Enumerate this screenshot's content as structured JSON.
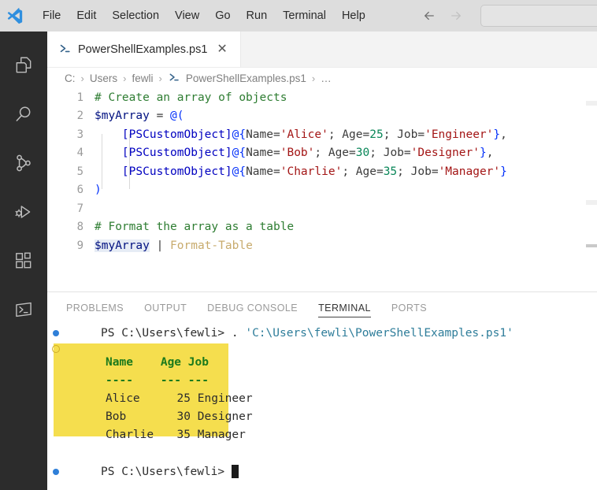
{
  "titlebar": {
    "logo_icon": "vscode-logo-icon",
    "menus": [
      "File",
      "Edit",
      "Selection",
      "View",
      "Go",
      "Run",
      "Terminal",
      "Help"
    ],
    "back_icon": "arrow-left-icon",
    "forward_icon": "arrow-right-icon",
    "search_value": "",
    "search_placeholder": ""
  },
  "activitybar": {
    "items": [
      {
        "name": "explorer",
        "icon": "files-icon"
      },
      {
        "name": "search",
        "icon": "search-icon"
      },
      {
        "name": "source-control",
        "icon": "source-control-icon"
      },
      {
        "name": "run-and-debug",
        "icon": "run-debug-icon"
      },
      {
        "name": "extensions",
        "icon": "extensions-icon"
      },
      {
        "name": "terminal",
        "icon": "terminal-prompt-icon"
      }
    ]
  },
  "editor": {
    "tab": {
      "label": "PowerShellExamples.ps1",
      "icon": "powershell-icon",
      "close_label": "✕",
      "active": true
    },
    "breadcrumbs": [
      {
        "label": "C:",
        "icon": ""
      },
      {
        "label": "Users",
        "icon": ""
      },
      {
        "label": "fewli",
        "icon": ""
      },
      {
        "label": "PowerShellExamples.ps1",
        "icon": "powershell-icon"
      },
      {
        "label": "…",
        "icon": ""
      }
    ],
    "breadcrumb_separator": "›",
    "lines": [
      {
        "number": "1",
        "tokens": [
          {
            "text": "# Create an array of objects",
            "cls": "t-comment"
          }
        ]
      },
      {
        "number": "2",
        "tokens": [
          {
            "text": "$myArray",
            "cls": "t-var"
          },
          {
            "text": " = ",
            "cls": "t-op"
          },
          {
            "text": "@(",
            "cls": "t-bracket"
          }
        ]
      },
      {
        "number": "3",
        "tokens": [
          {
            "text": "    ",
            "cls": "t-plain"
          },
          {
            "text": "[PSCustomObject]",
            "cls": "t-blue"
          },
          {
            "text": "@{",
            "cls": "t-bracket"
          },
          {
            "text": "Name=",
            "cls": "t-plain"
          },
          {
            "text": "'Alice'",
            "cls": "t-string"
          },
          {
            "text": "; Age=",
            "cls": "t-plain"
          },
          {
            "text": "25",
            "cls": "t-num"
          },
          {
            "text": "; Job=",
            "cls": "t-plain"
          },
          {
            "text": "'Engineer'",
            "cls": "t-string"
          },
          {
            "text": "}",
            "cls": "t-bracket"
          },
          {
            "text": ",",
            "cls": "t-plain"
          }
        ]
      },
      {
        "number": "4",
        "tokens": [
          {
            "text": "    ",
            "cls": "t-plain"
          },
          {
            "text": "[PSCustomObject]",
            "cls": "t-blue"
          },
          {
            "text": "@{",
            "cls": "t-bracket"
          },
          {
            "text": "Name=",
            "cls": "t-plain"
          },
          {
            "text": "'Bob'",
            "cls": "t-string"
          },
          {
            "text": "; Age=",
            "cls": "t-plain"
          },
          {
            "text": "30",
            "cls": "t-num"
          },
          {
            "text": "; Job=",
            "cls": "t-plain"
          },
          {
            "text": "'Designer'",
            "cls": "t-string"
          },
          {
            "text": "}",
            "cls": "t-bracket"
          },
          {
            "text": ",",
            "cls": "t-plain"
          }
        ]
      },
      {
        "number": "5",
        "tokens": [
          {
            "text": "    ",
            "cls": "t-plain"
          },
          {
            "text": "[PSCustomObject]",
            "cls": "t-blue"
          },
          {
            "text": "@{",
            "cls": "t-bracket"
          },
          {
            "text": "Name=",
            "cls": "t-plain"
          },
          {
            "text": "'Charlie'",
            "cls": "t-string"
          },
          {
            "text": "; Age=",
            "cls": "t-plain"
          },
          {
            "text": "35",
            "cls": "t-num"
          },
          {
            "text": "; Job=",
            "cls": "t-plain"
          },
          {
            "text": "'Manager'",
            "cls": "t-string"
          },
          {
            "text": "}",
            "cls": "t-bracket"
          }
        ]
      },
      {
        "number": "6",
        "tokens": [
          {
            "text": ")",
            "cls": "t-bracket"
          }
        ]
      },
      {
        "number": "7",
        "tokens": []
      },
      {
        "number": "8",
        "tokens": [
          {
            "text": "# Format the array as a table",
            "cls": "t-comment"
          }
        ]
      },
      {
        "number": "9",
        "tokens": [
          {
            "text": "$myArray",
            "cls": "t-var sel"
          },
          {
            "text": " ",
            "cls": "t-plain"
          },
          {
            "text": "|",
            "cls": "t-pipe"
          },
          {
            "text": " ",
            "cls": "t-plain"
          },
          {
            "text": "Format-Table",
            "cls": "t-cmd"
          }
        ]
      }
    ]
  },
  "panel": {
    "tabs": [
      {
        "label": "PROBLEMS",
        "active": false
      },
      {
        "label": "OUTPUT",
        "active": false
      },
      {
        "label": "DEBUG CONSOLE",
        "active": false
      },
      {
        "label": "TERMINAL",
        "active": true
      },
      {
        "label": "PORTS",
        "active": false
      }
    ],
    "terminal": {
      "command_line": {
        "marker": "command-marker-icon",
        "prompt": "PS C:\\Users\\fewli> ",
        "dot": ". ",
        "argument": "'C:\\Users\\fewli\\PowerShellExamples.ps1'"
      },
      "output_block": {
        "marker": "output-marker-icon",
        "highlight_color": "#f5de4e",
        "header": {
          "name": "Name",
          "age": "Age",
          "job": "Job"
        },
        "separator": {
          "name": "----",
          "age": "---",
          "job": "---"
        },
        "rows": [
          {
            "name": "Alice",
            "age": "25",
            "job": "Engineer"
          },
          {
            "name": "Bob",
            "age": "30",
            "job": "Designer"
          },
          {
            "name": "Charlie",
            "age": "35",
            "job": "Manager"
          }
        ]
      },
      "final_prompt": {
        "marker": "command-marker-icon",
        "prompt": "PS C:\\Users\\fewli> ",
        "cursor": true
      }
    }
  }
}
